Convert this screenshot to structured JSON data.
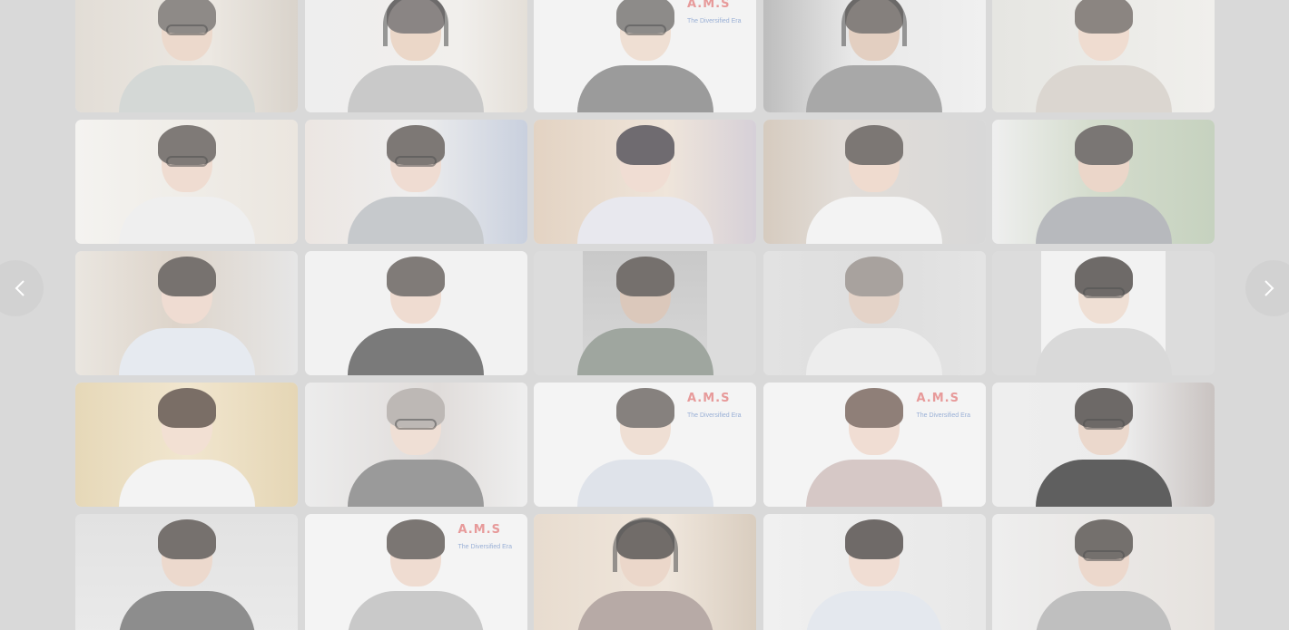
{
  "carousel": {
    "prev_icon": "chevron-left-icon",
    "next_icon": "chevron-right-icon"
  },
  "banner_logo_text": "A.M.S",
  "banner_tagline": "The Diversified Era",
  "colors": {
    "overlay": "#d9d9d9",
    "tile_light": "#ececec",
    "banner_logo": "#e79a9a",
    "banner_tag": "#9ab0d6"
  }
}
